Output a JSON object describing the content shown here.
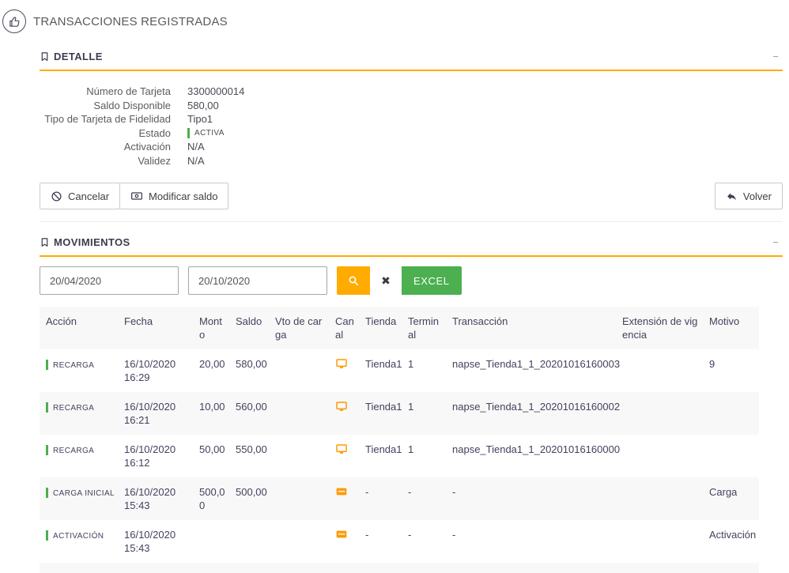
{
  "page": {
    "title": "TRANSACCIONES REGISTRADAS"
  },
  "detalle": {
    "title": "DETALLE",
    "collapse_label": "−",
    "fields": [
      {
        "label": "Número de Tarjeta",
        "value": "3300000014"
      },
      {
        "label": "Saldo Disponible",
        "value": "580,00"
      },
      {
        "label": "Tipo de Tarjeta de Fidelidad",
        "value": "Tipo1"
      },
      {
        "label": "Estado",
        "value": "ACTIVA",
        "status": true
      },
      {
        "label": "Activación",
        "value": "N/A"
      },
      {
        "label": "Validez",
        "value": "N/A"
      }
    ],
    "buttons": {
      "cancelar": "Cancelar",
      "modificar_saldo": "Modificar saldo",
      "volver": "Volver"
    }
  },
  "movimientos": {
    "title": "MOVIMIENTOS",
    "collapse_label": "−",
    "filters": {
      "date_from": "20/04/2020",
      "date_to": "20/10/2020",
      "search_icon": "magnifier-icon",
      "clear_label": "✖",
      "excel_label": "EXCEL"
    },
    "table": {
      "headers": [
        "Acción",
        "Fecha",
        "Monto",
        "Saldo",
        "Vto de carga",
        "Canal",
        "Tienda",
        "Terminal",
        "Transacción",
        "Extensión de vigencia",
        "Motivo"
      ],
      "rows": [
        {
          "accion": "RECARGA",
          "fecha": "16/10/2020 16:29",
          "monto": "20,00",
          "saldo": "580,00",
          "vto_de_carga": "",
          "canal_icon": "monitor-icon",
          "tienda": "Tienda1",
          "terminal": "1",
          "transaccion": "napse_Tienda1_1_20201016160003",
          "extension_de_vigencia": "",
          "motivo": "9"
        },
        {
          "accion": "RECARGA",
          "fecha": "16/10/2020 16:21",
          "monto": "10,00",
          "saldo": "560,00",
          "vto_de_carga": "",
          "canal_icon": "monitor-icon",
          "tienda": "Tienda1",
          "terminal": "1",
          "transaccion": "napse_Tienda1_1_20201016160002",
          "extension_de_vigencia": "",
          "motivo": ""
        },
        {
          "accion": "RECARGA",
          "fecha": "16/10/2020 16:12",
          "monto": "50,00",
          "saldo": "550,00",
          "vto_de_carga": "",
          "canal_icon": "monitor-icon",
          "tienda": "Tienda1",
          "terminal": "1",
          "transaccion": "napse_Tienda1_1_20201016160000",
          "extension_de_vigencia": "",
          "motivo": ""
        },
        {
          "accion": "CARGA INICIAL",
          "fecha": "16/10/2020 15:43",
          "monto": "500,00",
          "saldo": "500,00",
          "vto_de_carga": "",
          "canal_icon": "card-icon",
          "tienda": "-",
          "terminal": "-",
          "transaccion": "-",
          "extension_de_vigencia": "",
          "motivo": "Carga"
        },
        {
          "accion": "ACTIVACIÓN",
          "fecha": "16/10/2020 15:43",
          "monto": "",
          "saldo": "",
          "vto_de_carga": "",
          "canal_icon": "card-icon",
          "tienda": "-",
          "terminal": "-",
          "transaccion": "-",
          "extension_de_vigencia": "",
          "motivo": "Activación"
        }
      ]
    }
  },
  "colors": {
    "accent_orange": "#ffab00",
    "status_green": "#4caf50",
    "excel_green": "#4caf50",
    "canal_orange": "#ff9800",
    "text_dark": "#43425d"
  }
}
